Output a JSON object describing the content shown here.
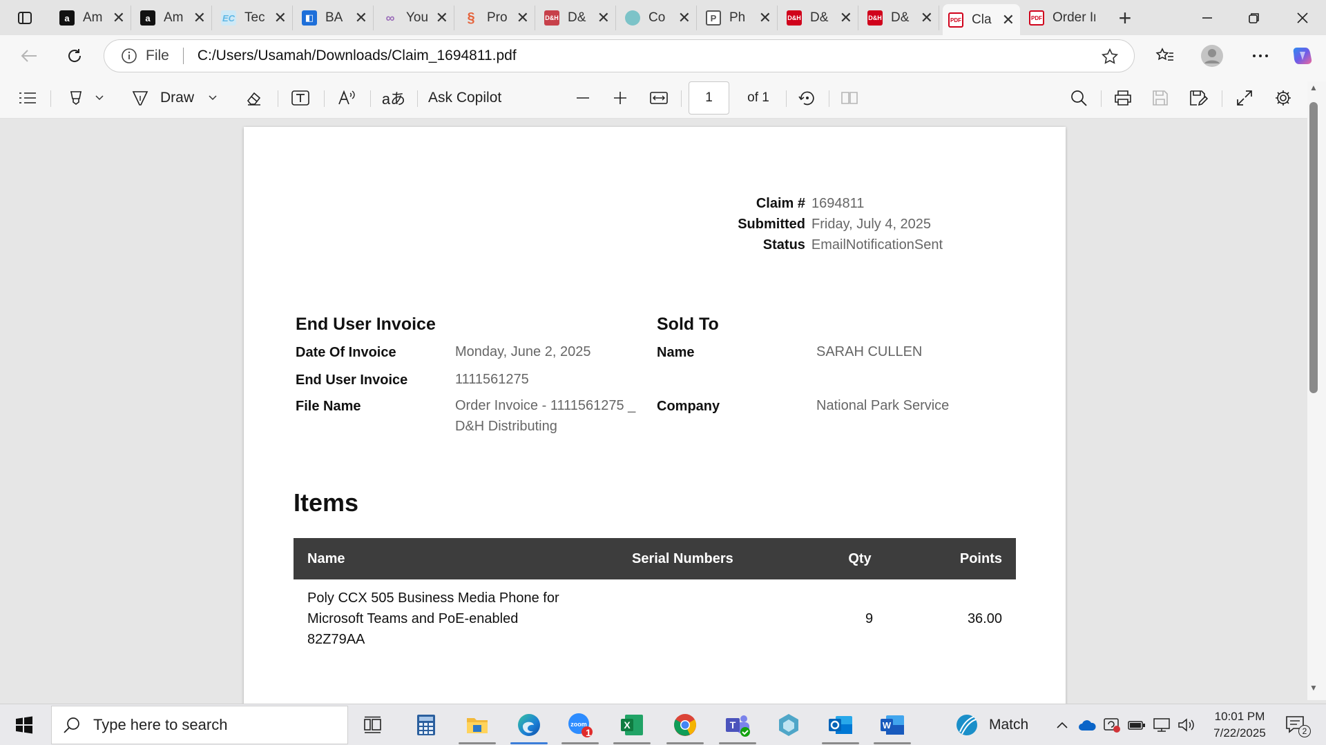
{
  "browser": {
    "tabs": [
      {
        "label": "Am",
        "icon": "amazon-icon",
        "color": "#111111"
      },
      {
        "label": "Am",
        "icon": "amazon-icon",
        "color": "#111111"
      },
      {
        "label": "Tec",
        "icon": "ec-icon",
        "color": "#5fb7e5"
      },
      {
        "label": "BA",
        "icon": "blue-doc-icon",
        "color": "#1e6fd9"
      },
      {
        "label": "You",
        "icon": "rings-icon",
        "color": "#9a6bb8"
      },
      {
        "label": "Pro",
        "icon": "swirl-icon",
        "color": "#e5623a"
      },
      {
        "label": "D&",
        "icon": "dh-icon",
        "color": "#c7404a"
      },
      {
        "label": "Co",
        "icon": "circle-icon",
        "color": "#7cc3c8"
      },
      {
        "label": "Ph",
        "icon": "doc-icon",
        "color": "#555555"
      },
      {
        "label": "D&",
        "icon": "dh-icon",
        "color": "#d0021b"
      },
      {
        "label": "D&",
        "icon": "dh-icon",
        "color": "#d0021b"
      },
      {
        "label": "Cla",
        "icon": "pdf-icon",
        "color": "#d0021b"
      },
      {
        "label": "Order In",
        "icon": "pdf-icon",
        "color": "#d0021b"
      }
    ],
    "address": {
      "scheme_label": "File",
      "url": "C:/Users/Usamah/Downloads/Claim_1694811.pdf"
    }
  },
  "pdf_toolbar": {
    "draw_label": "Draw",
    "copilot_label": "Ask Copilot",
    "page_value": "1",
    "page_total": "of 1"
  },
  "claim": {
    "claim_label": "Claim #",
    "claim_value": "1694811",
    "submitted_label": "Submitted",
    "submitted_value": "Friday, July 4, 2025",
    "status_label": "Status",
    "status_value": "EmailNotificationSent"
  },
  "invoice": {
    "title": "End User Invoice",
    "date_label": "Date Of Invoice",
    "date_value": "Monday, June 2, 2025",
    "number_label": "End User Invoice",
    "number_value": "1111561275",
    "file_label": "File Name",
    "file_value_line1": "Order Invoice - 1111561275 _",
    "file_value_line2": "D&H Distributing"
  },
  "sold_to": {
    "title": "Sold To",
    "name_label": "Name",
    "name_value": "SARAH CULLEN",
    "company_label": "Company",
    "company_value": "National Park Service"
  },
  "items": {
    "heading": "Items",
    "columns": {
      "name": "Name",
      "serial": "Serial Numbers",
      "qty": "Qty",
      "points": "Points"
    },
    "rows": [
      {
        "name_line1": "Poly CCX 505 Business Media Phone for",
        "name_line2": "Microsoft Teams and PoE-enabled",
        "name_line3": "82Z79AA",
        "serial": "",
        "qty": "9",
        "points": "36.00"
      }
    ]
  },
  "taskbar": {
    "search_placeholder": "Type here to search",
    "zoom_badge": "1",
    "weather_label": "Match",
    "clock_time": "10:01 PM",
    "clock_date": "7/22/2025",
    "notification_count": "2"
  }
}
